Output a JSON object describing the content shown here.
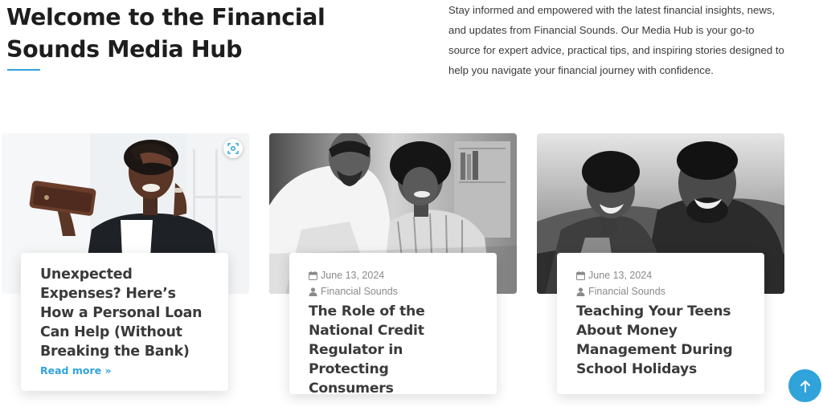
{
  "header": {
    "title": "Welcome to the Financial Sounds Media Hub",
    "intro": "Stay informed and empowered with the latest financial insights, news, and updates from Financial Sounds. Our Media Hub is your go-to source for expert advice, practical tips, and inspiring stories designed to help you navigate your financial journey with confidence."
  },
  "articles": [
    {
      "title": "Unexpected Expenses? Here’s How a Personal Loan Can Help (Without Breaking the Bank)",
      "read_more": "Read more »",
      "image_icon": "woman-holding-wallet-photo"
    },
    {
      "date": "June 13, 2024",
      "author": "Financial Sounds",
      "title": "The Role of the National Credit Regulator in Protecting Consumers",
      "image_icon": "couple-reviewing-documents-photo"
    },
    {
      "date": "June 13, 2024",
      "author": "Financial Sounds",
      "title": "Teaching Your Teens About Money Management During School Holidays",
      "image_icon": "father-and-son-smiling-photo"
    }
  ],
  "icons": {
    "lens": "visual-search-icon",
    "calendar": "calendar-icon",
    "user": "user-icon",
    "to_top": "arrow-up-icon"
  },
  "colors": {
    "accent": "#2fa3da",
    "heading": "#1d1d1d",
    "body": "#3a3a3a",
    "meta": "#8a8a8a"
  }
}
